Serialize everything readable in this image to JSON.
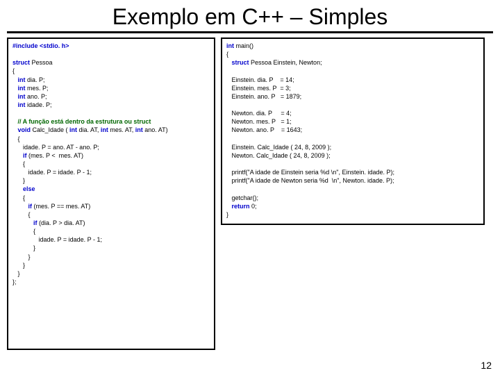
{
  "title": "Exemplo em C++ – Simples",
  "pagenum": "12",
  "left": {
    "l1a": "#include <stdio. h>",
    "l2a": "struct",
    "l2b": " Pessoa",
    "l3": "{",
    "l4a": "   int",
    "l4b": " dia. P;",
    "l5a": "   int",
    "l5b": " mes. P;",
    "l6a": "   int",
    "l6b": " ano. P;",
    "l7a": "   int",
    "l7b": " idade. P;",
    "l8": "   // A função está dentro da estrutura ou struct",
    "l9a": "   void",
    "l9b": " Calc_Idade ( ",
    "l9c": "int",
    "l9d": " dia. AT, ",
    "l9e": "int",
    "l9f": " mes. AT, ",
    "l9g": "int",
    "l9h": " ano. AT)",
    "l10": "   {",
    "l11": "      idade. P = ano. AT - ano. P;",
    "l12a": "      if",
    "l12b": " (mes. P <  mes. AT)",
    "l13": "      {",
    "l14": "         idade. P = idade. P - 1;",
    "l15": "      }",
    "l16a": "      else",
    "l17": "      {",
    "l18a": "         if",
    "l18b": " (mes. P == mes. AT)",
    "l19": "         {",
    "l20a": "            if",
    "l20b": " (dia. P > dia. AT)",
    "l21": "            {",
    "l22": "               idade. P = idade. P - 1;",
    "l23": "            }",
    "l24": "         }",
    "l25": "      }",
    "l26": "   }",
    "l27": "};"
  },
  "right": {
    "l1a": "int",
    "l1b": " main()",
    "l2": "{",
    "l3a": "   struct",
    "l3b": " Pessoa Einstein, Newton;",
    "l4": "   Einstein. dia. P    = 14;",
    "l5": "   Einstein. mes. P  = 3;",
    "l6": "   Einstein. ano. P   = 1879;",
    "l7": "   Newton. dia. P     = 4;",
    "l8": "   Newton. mes. P   = 1;",
    "l9": "   Newton. ano. P    = 1643;",
    "l10": "   Einstein. Calc_Idade ( 24, 8, 2009 );",
    "l11": "   Newton. Calc_Idade ( 24, 8, 2009 );",
    "l12": "   printf(\"A idade de Einstein seria %d \\n\", Einstein. idade. P);",
    "l13": "   printf(\"A idade de Newton seria %d  \\n\", Newton. idade. P);",
    "l14": "   getchar();",
    "l15a": "   return",
    "l15b": " 0;",
    "l16": "}"
  }
}
